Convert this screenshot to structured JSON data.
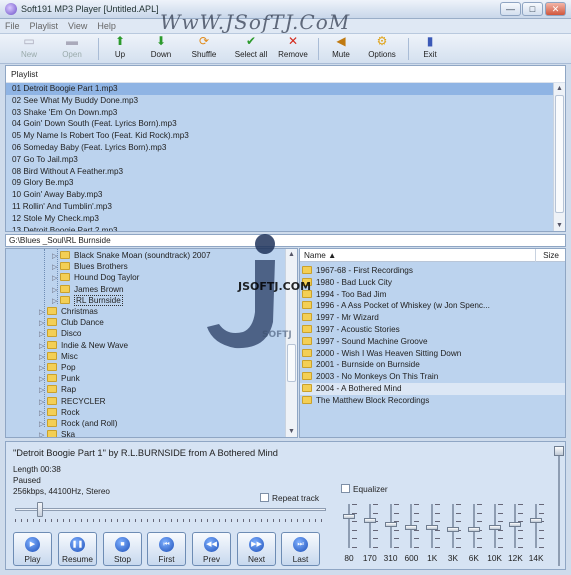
{
  "window": {
    "title": "Soft191 MP3 Player [Untitled.APL]",
    "controls": [
      "—",
      "□",
      "✕"
    ]
  },
  "menu": [
    "File",
    "Playlist",
    "View",
    "Help"
  ],
  "toolbar": [
    {
      "label": "New",
      "icon": "new-icon",
      "enabled": false
    },
    {
      "label": "Open",
      "icon": "open-folder-icon",
      "enabled": false
    },
    {
      "label": "Up",
      "icon": "up-arrow-icon",
      "enabled": true
    },
    {
      "label": "Down",
      "icon": "down-arrow-icon",
      "enabled": true
    },
    {
      "label": "Shuffle",
      "icon": "shuffle-icon",
      "enabled": true
    },
    {
      "label": "Select all",
      "icon": "select-all-icon",
      "enabled": true
    },
    {
      "label": "Remove",
      "icon": "remove-icon",
      "enabled": true
    },
    {
      "label": "Mute",
      "icon": "mute-icon",
      "enabled": true
    },
    {
      "label": "Options",
      "icon": "options-icon",
      "enabled": true
    },
    {
      "label": "Exit",
      "icon": "exit-icon",
      "enabled": true
    }
  ],
  "playlist": {
    "header": "Playlist",
    "items": [
      "01 Detroit Boogie Part 1.mp3",
      "02 See What My Buddy Done.mp3",
      "03 Shake 'Em On Down.mp3",
      "04 Goin' Down South (Feat. Lyrics Born).mp3",
      "05 My Name Is Robert Too (Feat. Kid Rock).mp3",
      "06 Someday Baby (Feat. Lyrics Born).mp3",
      "07 Go To Jail.mp3",
      "08 Bird Without A Feather.mp3",
      "09 Glory Be.mp3",
      "10 Goin' Away Baby.mp3",
      "11 Rollin' And Tumblin'.mp3",
      "12 Stole My Check.mp3",
      "13 Detroit Boogie Part 2.mp3"
    ],
    "selected_index": 0
  },
  "path": "G:\\Blues _Soul\\RL Burnside",
  "tree": {
    "items": [
      {
        "label": "Black Snake Moan (soundtrack) 2007",
        "level": 2
      },
      {
        "label": "Blues Brothers",
        "level": 2
      },
      {
        "label": "Hound Dog Taylor",
        "level": 2
      },
      {
        "label": "James Brown",
        "level": 2
      },
      {
        "label": "RL Burnside",
        "level": 2,
        "selected": true
      },
      {
        "label": "Christmas",
        "level": 1
      },
      {
        "label": "Club Dance",
        "level": 1
      },
      {
        "label": "Disco",
        "level": 1
      },
      {
        "label": "Indie & New Wave",
        "level": 1
      },
      {
        "label": "Misc",
        "level": 1
      },
      {
        "label": "Pop",
        "level": 1
      },
      {
        "label": "Punk",
        "level": 1
      },
      {
        "label": "Rap",
        "level": 1
      },
      {
        "label": "RECYCLER",
        "level": 1
      },
      {
        "label": "Rock",
        "level": 1
      },
      {
        "label": "Rock (and Roll)",
        "level": 1
      },
      {
        "label": "Ska",
        "level": 1
      }
    ]
  },
  "files": {
    "columns": {
      "name": "Name",
      "size": "Size"
    },
    "items": [
      "1967-68 - First Recordings",
      "1980 - Bad Luck City",
      "1994 - Too Bad Jim",
      "1996 - A Ass Pocket of Whiskey (w Jon Spenc...",
      "1997 - Mr Wizard",
      "1997 - Acoustic Stories",
      "1997 - Sound Machine Groove",
      "2000 - Wish I Was Heaven Sitting Down",
      "2001 - Burnside on Burnside",
      "2003 - No Monkeys On This Train",
      "2004 - A Bothered Mind",
      "The Matthew Block Recordings"
    ],
    "selected_index": 10
  },
  "now_playing": {
    "track": "\"Detroit Boogie Part 1\" by R.L.BURNSIDE from A Bothered Mind",
    "length": "Length  00:38",
    "status": "Paused",
    "format": "256kbps, 44100Hz, Stereo",
    "repeat_label": "Repeat track",
    "repeat_checked": false,
    "position_fraction": 0.07
  },
  "transport": [
    {
      "label": "Play",
      "icon": "play-icon",
      "glyph": "▶"
    },
    {
      "label": "Resume",
      "icon": "pause-icon",
      "glyph": "❚❚"
    },
    {
      "label": "Stop",
      "icon": "stop-icon",
      "glyph": "■"
    },
    {
      "label": "First",
      "icon": "first-track-icon",
      "glyph": "⏮"
    },
    {
      "label": "Prev",
      "icon": "previous-track-icon",
      "glyph": "◀◀"
    },
    {
      "label": "Next",
      "icon": "next-track-icon",
      "glyph": "▶▶"
    },
    {
      "label": "Last",
      "icon": "last-track-icon",
      "glyph": "⏭"
    }
  ],
  "equalizer": {
    "label": "Equalizer",
    "enabled": false,
    "bands": [
      {
        "label": "80",
        "level": 0.25
      },
      {
        "label": "170",
        "level": 0.35
      },
      {
        "label": "310",
        "level": 0.45
      },
      {
        "label": "600",
        "level": 0.55
      },
      {
        "label": "1K",
        "level": 0.55
      },
      {
        "label": "3K",
        "level": 0.6
      },
      {
        "label": "6K",
        "level": 0.6
      },
      {
        "label": "10K",
        "level": 0.55
      },
      {
        "label": "12K",
        "level": 0.45
      },
      {
        "label": "14K",
        "level": 0.35
      }
    ],
    "volume_fraction": 1.0
  },
  "watermarks": {
    "top": "WwW.JSofTJ.CoM",
    "center": "JSOFTJ.COM",
    "logo_text": "SOFTJ"
  }
}
